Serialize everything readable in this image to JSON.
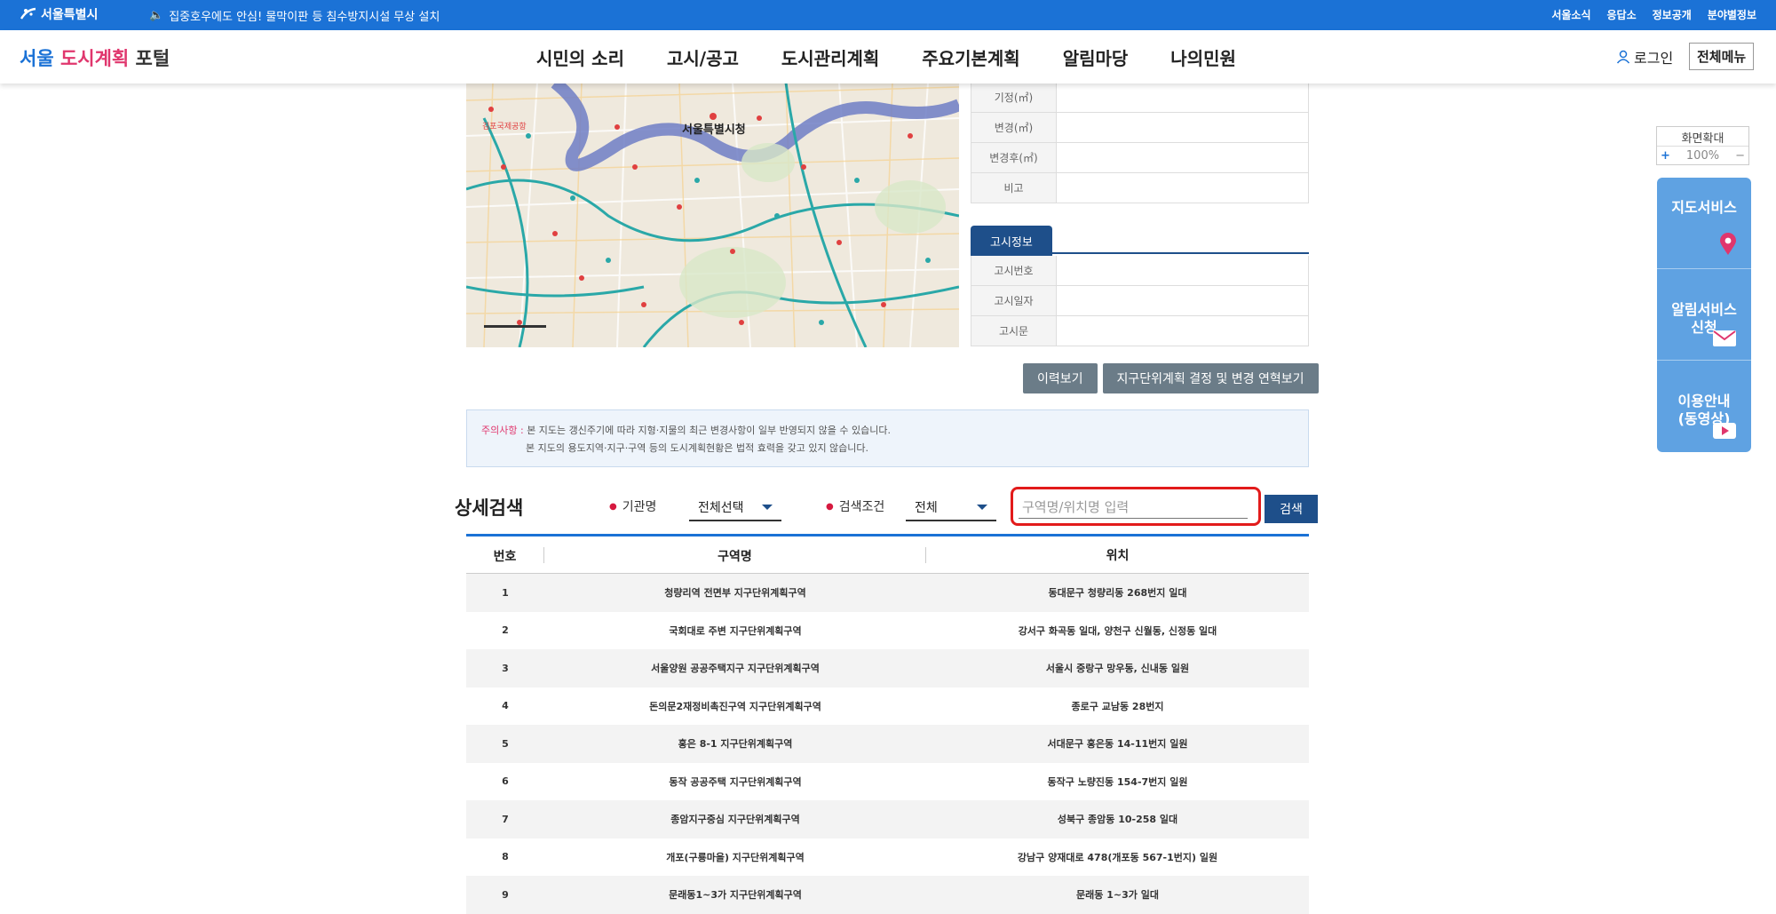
{
  "topbar": {
    "city_logo": "서울특별시",
    "notice": "집중호우에도 안심! 물막이판 등 침수방지시설 무상 설치",
    "links": [
      "서울소식",
      "응답소",
      "정보공개",
      "분야별정보"
    ]
  },
  "header": {
    "brand_part1": "서울",
    "brand_part2": "도시계획",
    "brand_part3": "포털",
    "nav": [
      "시민의 소리",
      "고시/공고",
      "도시관리계획",
      "주요기본계획",
      "알림마당",
      "나의민원"
    ],
    "login": "로그인",
    "all_menu": "전체메뉴"
  },
  "map": {
    "labels": [
      "서울특별시청",
      "김포국제공항"
    ]
  },
  "info_table": {
    "rows": [
      "기정(㎡)",
      "변경(㎡)",
      "변경후(㎡)",
      "비고"
    ],
    "notice_tab": "고시정보",
    "notice_rows": [
      "고시번호",
      "고시일자",
      "고시문"
    ]
  },
  "buttons": {
    "history": "이력보기",
    "decision": "지구단위계획 결정 및 변경 연혁보기"
  },
  "caution": {
    "label": "주의사항 :",
    "line1": "본 지도는 갱신주기에 따라 지형·지물의 최근 변경사항이 일부 반영되지 않을 수 있습니다.",
    "line2": "본 지도의 용도지역·지구·구역 등의 도시계획현황은 법적 효력을 갖고 있지 않습니다."
  },
  "search": {
    "title": "상세검색",
    "agency_label": "기관명",
    "agency_value": "전체선택",
    "condition_label": "검색조건",
    "condition_value": "전체",
    "keyword_placeholder": "구역명/위치명 입력",
    "button": "검색"
  },
  "table": {
    "headers": [
      "번호",
      "구역명",
      "위치"
    ],
    "rows": [
      {
        "no": "1",
        "name": "청량리역 전면부 지구단위계획구역",
        "loc": "동대문구 청량리동 268번지 일대"
      },
      {
        "no": "2",
        "name": "국회대로 주변 지구단위계획구역",
        "loc": "강서구 화곡동 일대, 양천구 신월동, 신정동 일대"
      },
      {
        "no": "3",
        "name": "서울양원 공공주택지구 지구단위계획구역",
        "loc": "서울시 중랑구 망우동, 신내동 일원"
      },
      {
        "no": "4",
        "name": "돈의문2재정비촉진구역 지구단위계획구역",
        "loc": "종로구 교남동 28번지"
      },
      {
        "no": "5",
        "name": "홍은 8-1 지구단위계획구역",
        "loc": "서대문구 홍은동 14-11번지 일원"
      },
      {
        "no": "6",
        "name": "동작 공공주택 지구단위계획구역",
        "loc": "동작구 노량진동 154-7번지 일원"
      },
      {
        "no": "7",
        "name": "종암지구중심 지구단위계획구역",
        "loc": "성북구 종암동 10-258 일대"
      },
      {
        "no": "8",
        "name": "개포(구룡마을) 지구단위계획구역",
        "loc": "강남구 양재대로 478(개포동 567-1번지) 일원"
      },
      {
        "no": "9",
        "name": "문래동1~3가 지구단위계획구역",
        "loc": "문래동 1~3가 일대"
      }
    ]
  },
  "side": {
    "zoom_title": "화면확대",
    "zoom_plus": "+",
    "zoom_value": "100%",
    "zoom_minus": "−",
    "items": [
      "지도서비스",
      "알림서비스\n신청",
      "이용안내\n(동영상)"
    ]
  }
}
